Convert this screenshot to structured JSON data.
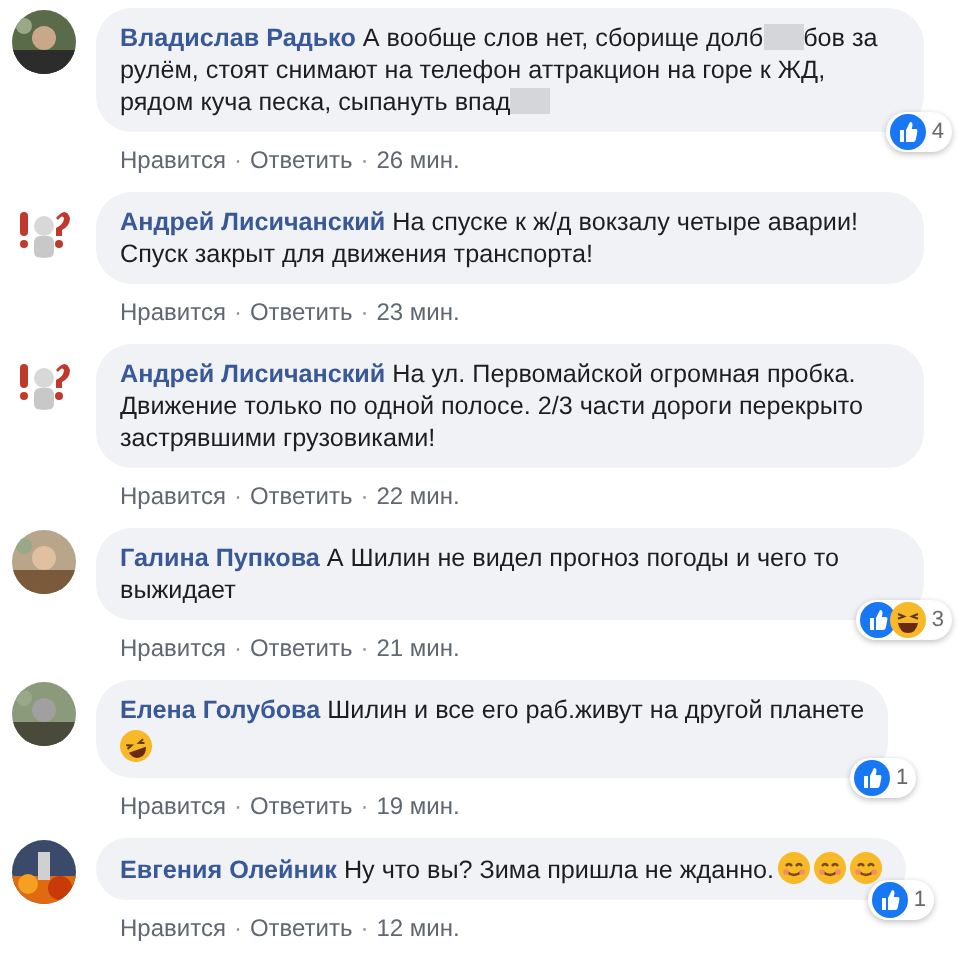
{
  "comments": [
    {
      "author": "Владислав Радько",
      "parts": [
        {
          "kind": "text",
          "text": "А вообще слов нет, сборище долб"
        },
        {
          "kind": "blur"
        },
        {
          "kind": "text",
          "text": "бов за рулём, стоят снимают на телефон аттракцион на горе к ЖД, рядом куча песка, сыпануть впад"
        },
        {
          "kind": "blur"
        }
      ],
      "reactions": {
        "kinds": [
          {
            "kind": "like"
          }
        ],
        "count": "4"
      },
      "actions": [
        {
          "kind": "link",
          "text": "Нравится"
        },
        {
          "kind": "separator",
          "text": "·"
        },
        {
          "kind": "link",
          "text": "Ответить"
        },
        {
          "kind": "separator",
          "text": "·"
        },
        {
          "kind": "time",
          "text": "26 мин."
        }
      ]
    },
    {
      "author": "Андрей Лисичанский",
      "parts": [
        {
          "kind": "text",
          "text": "На спуске к ж/д вокзалу четыре аварии! Спуск закрыт для движения транспорта!"
        }
      ],
      "actions": [
        {
          "kind": "link",
          "text": "Нравится"
        },
        {
          "kind": "separator",
          "text": "·"
        },
        {
          "kind": "link",
          "text": "Ответить"
        },
        {
          "kind": "separator",
          "text": "·"
        },
        {
          "kind": "time",
          "text": "23 мин."
        }
      ]
    },
    {
      "author": "Андрей Лисичанский",
      "parts": [
        {
          "kind": "text",
          "text": "На ул. Первомайской огромная пробка. Движение только по одной полосе. 2/3 части дороги перекрыто застрявшими грузовиками!"
        }
      ],
      "actions": [
        {
          "kind": "link",
          "text": "Нравится"
        },
        {
          "kind": "separator",
          "text": "·"
        },
        {
          "kind": "link",
          "text": "Ответить"
        },
        {
          "kind": "separator",
          "text": "·"
        },
        {
          "kind": "time",
          "text": "22 мин."
        }
      ]
    },
    {
      "author": "Галина Пупкова",
      "parts": [
        {
          "kind": "text",
          "text": "А Шилин не видел прогноз погоды и чего то выжидает"
        }
      ],
      "reactions": {
        "kinds": [
          {
            "kind": "like"
          },
          {
            "kind": "haha"
          }
        ],
        "count": "3"
      },
      "actions": [
        {
          "kind": "link",
          "text": "Нравится"
        },
        {
          "kind": "separator",
          "text": "·"
        },
        {
          "kind": "link",
          "text": "Ответить"
        },
        {
          "kind": "separator",
          "text": "·"
        },
        {
          "kind": "time",
          "text": "21 мин."
        }
      ]
    },
    {
      "author": "Елена Голубова",
      "parts": [
        {
          "kind": "text",
          "text": "Шилин и все его раб.живут на другой планете"
        },
        {
          "kind": "break"
        },
        {
          "kind": "rofl"
        }
      ],
      "reactions": {
        "kinds": [
          {
            "kind": "like"
          }
        ],
        "count": "1"
      },
      "actions": [
        {
          "kind": "link",
          "text": "Нравится"
        },
        {
          "kind": "separator",
          "text": "·"
        },
        {
          "kind": "link",
          "text": "Ответить"
        },
        {
          "kind": "separator",
          "text": "·"
        },
        {
          "kind": "time",
          "text": "19 мин."
        }
      ]
    },
    {
      "author": "Евгения Олейник",
      "parts": [
        {
          "kind": "text",
          "text": "Ну что вы? Зима пришла не жданно."
        },
        {
          "kind": "smile"
        },
        {
          "kind": "smile"
        },
        {
          "kind": "smile"
        }
      ],
      "reactions": {
        "kinds": [
          {
            "kind": "like"
          }
        ],
        "count": "1"
      },
      "actions": [
        {
          "kind": "link",
          "text": "Нравится"
        },
        {
          "kind": "separator",
          "text": "·"
        },
        {
          "kind": "link",
          "text": "Ответить"
        },
        {
          "kind": "separator",
          "text": "·"
        },
        {
          "kind": "time",
          "text": "12 мин."
        }
      ]
    }
  ]
}
